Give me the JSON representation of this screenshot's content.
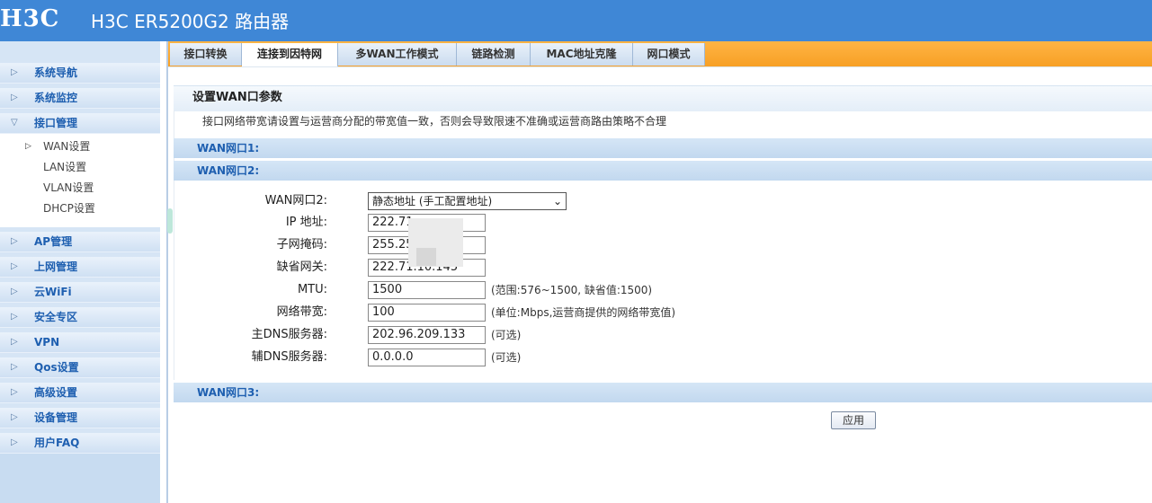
{
  "header": {
    "logo": "H3C",
    "title": "H3C ER5200G2 路由器"
  },
  "sidebar": {
    "groups_top": [
      {
        "label": "系统导航"
      },
      {
        "label": "系统监控"
      },
      {
        "label": "接口管理"
      }
    ],
    "submenu": [
      {
        "label": "WAN设置"
      },
      {
        "label": "LAN设置"
      },
      {
        "label": "VLAN设置"
      },
      {
        "label": "DHCP设置"
      }
    ],
    "groups_bottom": [
      {
        "label": "AP管理"
      },
      {
        "label": "上网管理"
      },
      {
        "label": "云WiFi"
      },
      {
        "label": "安全专区"
      },
      {
        "label": "VPN"
      },
      {
        "label": "Qos设置"
      },
      {
        "label": "高级设置"
      },
      {
        "label": "设备管理"
      },
      {
        "label": "用户FAQ"
      }
    ]
  },
  "tabs": [
    {
      "label": "接口转换"
    },
    {
      "label": "连接到因特网"
    },
    {
      "label": "多WAN工作模式"
    },
    {
      "label": "链路检测"
    },
    {
      "label": "MAC地址克隆"
    },
    {
      "label": "网口模式"
    }
  ],
  "panel": {
    "title": "设置WAN口参数",
    "note": "接口网络带宽请设置与运营商分配的带宽值一致，否则会导致限速不准确或运营商路由策略不合理"
  },
  "wan_sections": [
    {
      "label": "WAN网口1:"
    },
    {
      "label": "WAN网口2:"
    },
    {
      "label": "WAN网口3:"
    }
  ],
  "form": {
    "mode_label": "WAN网口2:",
    "mode_value": "静态地址 (手工配置地址)",
    "fields": [
      {
        "label": "IP 地址:",
        "value": "222.71",
        "hint": ""
      },
      {
        "label": "子网掩码:",
        "value": "255.25",
        "hint": ""
      },
      {
        "label": "缺省网关:",
        "value": "222.71.10.145",
        "hint": ""
      },
      {
        "label": "MTU:",
        "value": "1500",
        "hint": "(范围:576~1500, 缺省值:1500)"
      },
      {
        "label": "网络带宽:",
        "value": "100",
        "hint": "(单位:Mbps,运营商提供的网络带宽值)"
      },
      {
        "label": "主DNS服务器:",
        "value": "202.96.209.133",
        "hint": "(可选)"
      },
      {
        "label": "辅DNS服务器:",
        "value": "0.0.0.0",
        "hint": "(可选)"
      }
    ],
    "apply_label": "应用"
  }
}
